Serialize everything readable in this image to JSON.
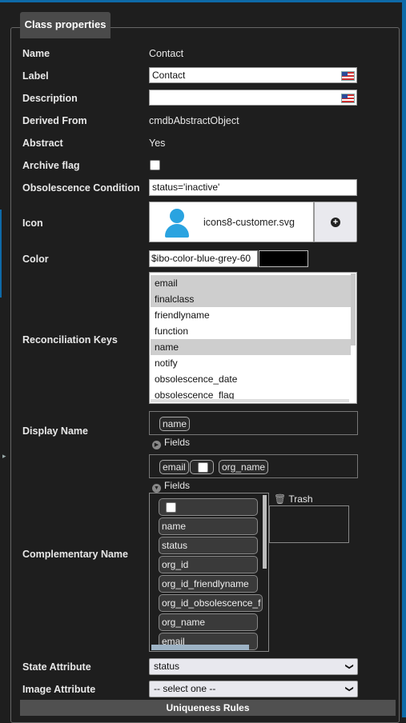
{
  "panel": {
    "title": "Class properties"
  },
  "fields": {
    "name": {
      "label": "Name",
      "value": "Contact"
    },
    "label": {
      "label": "Label",
      "value": "Contact"
    },
    "description": {
      "label": "Description",
      "value": ""
    },
    "derived_from": {
      "label": "Derived From",
      "value": "cmdbAbstractObject"
    },
    "abstract": {
      "label": "Abstract",
      "value": "Yes"
    },
    "archive_flag": {
      "label": "Archive flag",
      "checked": false
    },
    "obsolescence": {
      "label": "Obsolescence Condition",
      "value": "status='inactive'"
    },
    "icon": {
      "label": "Icon",
      "filename": "icons8-customer.svg",
      "icon": "person-icon",
      "add_icon": "plus-circle-icon"
    },
    "color": {
      "label": "Color",
      "value": "$ibo-color-blue-grey-60",
      "swatch": "#000000"
    },
    "reconciliation": {
      "label": "Reconciliation Keys",
      "options": [
        {
          "text": "email",
          "selected": true
        },
        {
          "text": "finalclass",
          "selected": true
        },
        {
          "text": "friendlyname",
          "selected": false
        },
        {
          "text": "function",
          "selected": false
        },
        {
          "text": "name",
          "selected": true
        },
        {
          "text": "notify",
          "selected": false
        },
        {
          "text": "obsolescence_date",
          "selected": false
        },
        {
          "text": "obsolescence_flag",
          "selected": false
        }
      ]
    },
    "display_name": {
      "label": "Display Name",
      "tokens": [
        "name"
      ],
      "fields_label": "Fields",
      "fields_state": "collapsed"
    },
    "complementary_name": {
      "label": "Complementary Name",
      "tokens": [
        "email",
        "",
        "org_name"
      ],
      "fields_label": "Fields",
      "fields_state": "expanded",
      "field_list": [
        "",
        "name",
        "status",
        "org_id",
        "org_id_friendlyname",
        "org_id_obsolescence_f",
        "org_name",
        "email"
      ],
      "trash_label": "Trash"
    },
    "state_attribute": {
      "label": "State Attribute",
      "value": "status"
    },
    "image_attribute": {
      "label": "Image Attribute",
      "value": "-- select one --"
    }
  },
  "footer": {
    "uniqueness_label": "Uniqueness Rules"
  }
}
